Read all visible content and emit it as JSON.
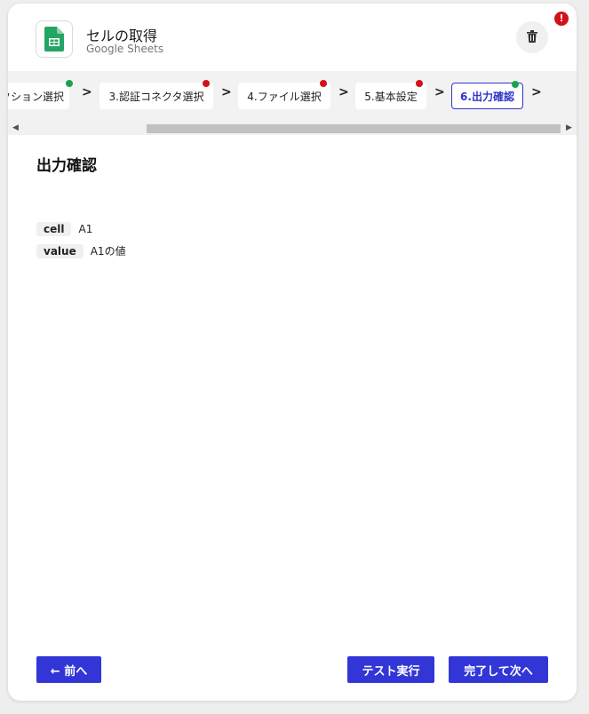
{
  "header": {
    "title": "セルの取得",
    "subtitle": "Google Sheets",
    "alert_badge": "!",
    "icons": {
      "app": "google-sheets-icon",
      "delete": "trash-icon",
      "alert": "exclamation-icon"
    }
  },
  "steps": [
    {
      "label": "アクション選択",
      "status": "ok",
      "active": false
    },
    {
      "label": "3.認証コネクタ選択",
      "status": "err",
      "active": false
    },
    {
      "label": "4.ファイル選択",
      "status": "err",
      "active": false
    },
    {
      "label": "5.基本設定",
      "status": "err",
      "active": false
    },
    {
      "label": "6.出力確認",
      "status": "ok",
      "active": true
    }
  ],
  "main": {
    "section_title": "出力確認",
    "outputs": [
      {
        "key": "cell",
        "value": "A1"
      },
      {
        "key": "value",
        "value": "A1の値"
      }
    ]
  },
  "footer": {
    "prev_label": "← 前へ",
    "test_label": "テスト実行",
    "next_label": "完了して次へ"
  },
  "colors": {
    "primary": "#3236d6",
    "error": "#d0121b",
    "success": "#1aa34a",
    "sheets_green": "#23a566"
  }
}
